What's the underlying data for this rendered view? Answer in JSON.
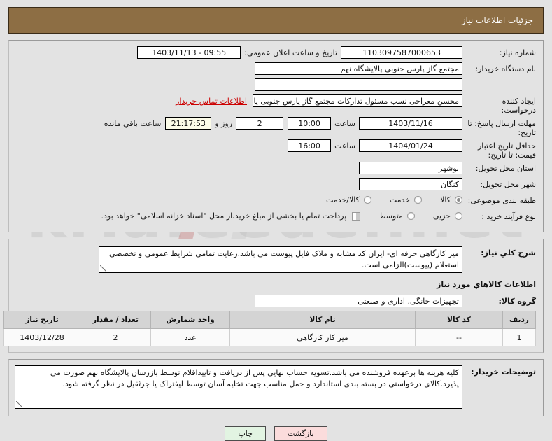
{
  "header": {
    "title": "جزئیات اطلاعات نیاز"
  },
  "form": {
    "need_number": {
      "label": "شماره نیاز:",
      "value": "1103097587000653"
    },
    "announce_datetime": {
      "label": "تاریخ و ساعت اعلان عمومی:",
      "value": "1403/11/13 - 09:55"
    },
    "buyer_org": {
      "label": "نام دستگاه خریدار:",
      "value": "مجتمع گاز پارس جنوبی  پالایشگاه نهم"
    },
    "blank_field": {
      "value": ""
    },
    "requester": {
      "label": "ایجاد کننده درخواست:",
      "value": "محسن معراجی نسب مسئول تدارکات مجتمع گاز پارس جنوبی  پالایشگاه نهم",
      "contact_link": "اطلاعات تماس خریدار"
    },
    "response_deadline": {
      "label": "مهلت ارسال پاسخ: تا تاریخ:",
      "date": "1403/11/16",
      "time_label": "ساعت",
      "time": "10:00",
      "days_value": "2",
      "days_sep": "روز و",
      "countdown": "21:17:53",
      "countdown_suffix": "ساعت باقي مانده"
    },
    "price_validity": {
      "label": "حداقل تاریخ اعتبار قیمت: تا تاریخ:",
      "date": "1404/01/24",
      "time_label": "ساعت",
      "time": "16:00"
    },
    "delivery_province": {
      "label": "استان محل تحویل:",
      "value": "بوشهر"
    },
    "delivery_city": {
      "label": "شهر محل تحویل:",
      "value": "کنگان"
    },
    "subject_category": {
      "label": "طبقه بندی موضوعی:",
      "options": [
        "کالا",
        "خدمت",
        "کالا/خدمت"
      ],
      "selected": "کالا"
    },
    "purchase_process": {
      "label": "نوع فرآیند خرید :",
      "options": [
        "جزیی",
        "متوسط"
      ],
      "selected": "",
      "checkbox_text": "پرداخت تمام یا بخشی از مبلغ خرید،از محل \"اسناد خزانه اسلامی\" خواهد بود.",
      "checkbox_checked": false
    }
  },
  "need_description": {
    "label": "شرح كلي نياز:",
    "text": "میز کارگاهی حرفه ای- ایران کد مشابه و ملاک فایل پیوست می باشد.رعایت تمامی شرایط عمومی و تخصصی استعلام (پیوست)الزامی است."
  },
  "goods_section": {
    "heading": "اطلاعات كالاهاي مورد نياز",
    "group": {
      "label": "گروه کالا:",
      "value": "تجهیزات خانگی، اداری و صنعتی"
    },
    "columns": [
      "ردیف",
      "کد کالا",
      "نام کالا",
      "واحد شمارش",
      "تعداد / مقدار",
      "تاریخ نیاز"
    ],
    "rows": [
      {
        "radif": "1",
        "code": "--",
        "name": "میز کار کارگاهی",
        "unit": "عدد",
        "qty": "2",
        "date": "1403/12/28"
      }
    ]
  },
  "buyer_notes": {
    "label": "توضیحات خریدار:",
    "text": "کلیه هزینه ها برعهده فروشنده می باشد.تسویه حساب نهایی پس از دریافت و تاییداقلام توسط بازرسان پالایشگاه نهم صورت می پذیرد.کالای درخواستی در بسته بندی استاندارد و حمل مناسب جهت تخلیه آسان توسط لیفتراک یا جرثقیل در نظر گرفته شود."
  },
  "buttons": {
    "print": "چاپ",
    "back": "بازگشت"
  },
  "watermark": {
    "text": "kriafeeder.net"
  },
  "colors": {
    "header_bg": "#8d6e44",
    "link_red": "#cc0000",
    "print_btn": "#e2f4e2",
    "back_btn": "#fbdcdc",
    "countdown_bg": "#fbfbe8"
  }
}
